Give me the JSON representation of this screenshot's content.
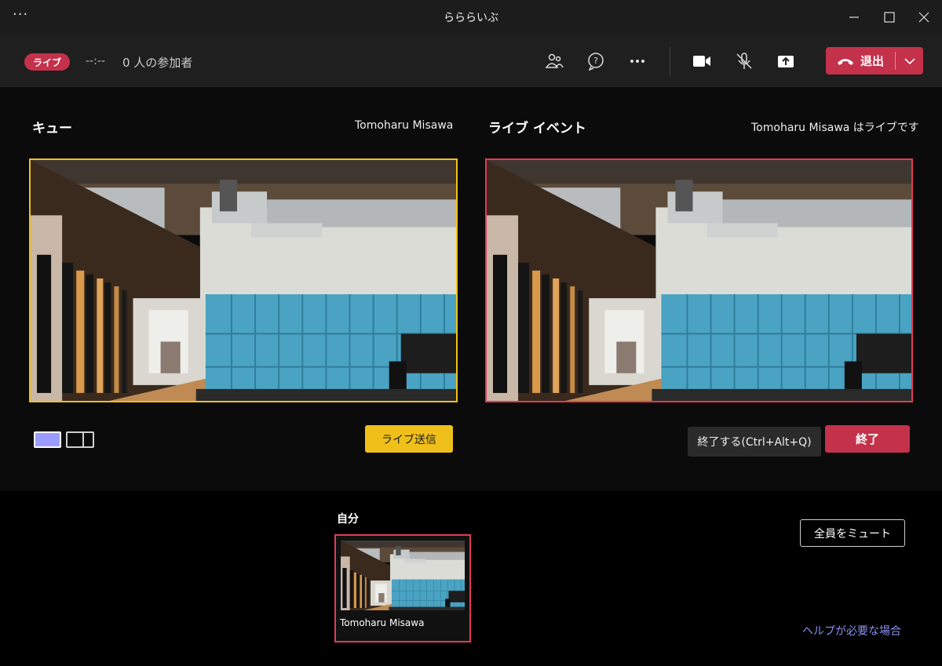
{
  "window": {
    "title": "らららいぶ",
    "menu_glyph": "···"
  },
  "meeting_bar": {
    "live_badge": "ライブ",
    "timer": "--:--",
    "participants": "0 人の参加者",
    "leave_label": "退出",
    "icons": [
      "participants-icon",
      "chat-icon",
      "more-icon",
      "camera-icon",
      "mic-off-icon",
      "share-icon",
      "phone-hangup-icon",
      "chevron-down-icon"
    ]
  },
  "queue": {
    "title": "キュー",
    "presenter": "Tomoharu Misawa",
    "send_live_label": "ライブ送信",
    "border_color": "#f0c01a"
  },
  "live_event": {
    "title": "ライブ イベント",
    "status": "Tomoharu Misawa はライブです",
    "end_shortcut_label": "終了する(Ctrl+Alt+Q)",
    "end_label": "終了",
    "border_color": "#e23a58"
  },
  "self_view": {
    "label": "自分",
    "name": "Tomoharu Misawa"
  },
  "bottom": {
    "mute_all_label": "全員をミュート",
    "help_link": "ヘルプが必要な場合"
  },
  "colors": {
    "accent_red": "#c4314b",
    "accent_yellow": "#f0c01a",
    "link": "#8b8ff0",
    "layout_selected": "#9a9dff"
  }
}
